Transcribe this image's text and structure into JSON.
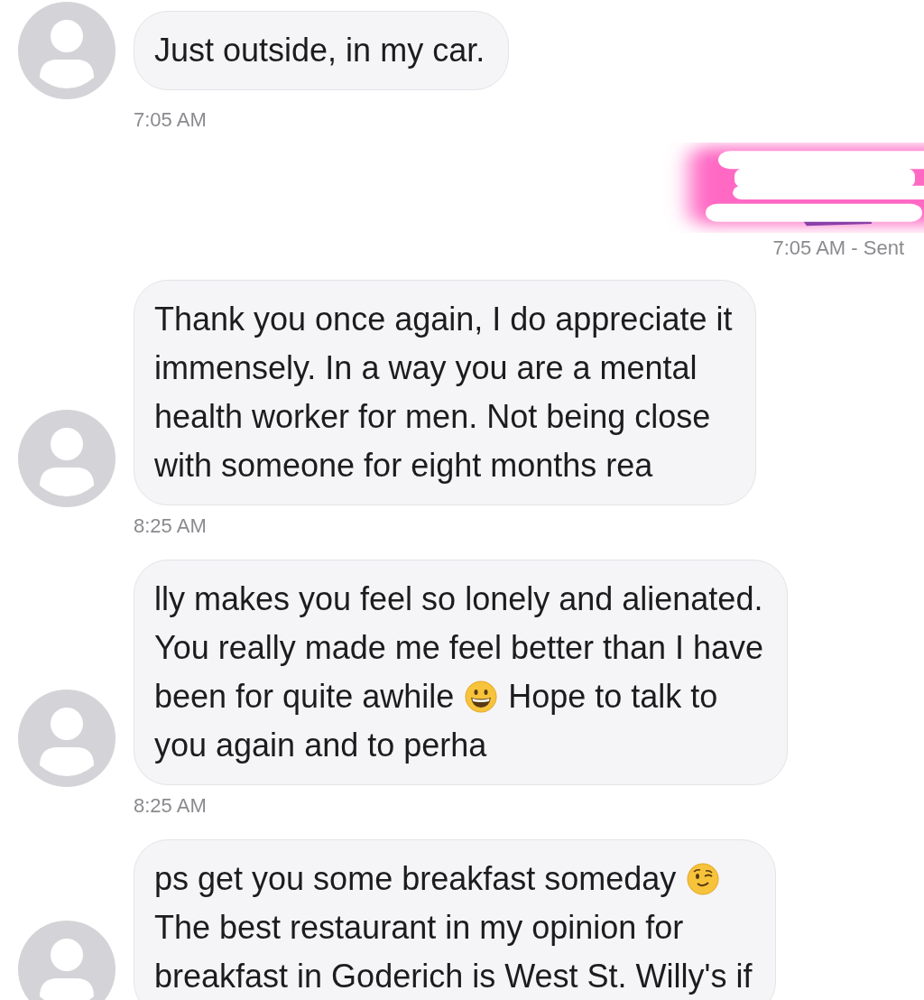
{
  "messages": [
    {
      "kind": "received",
      "lines": [
        [
          "Just outside, in my car."
        ]
      ],
      "time": "7:05 AM"
    },
    {
      "kind": "redacted",
      "time": "7:05 AM - Sent"
    },
    {
      "kind": "received",
      "lines": [
        [
          "Thank you once again, I do appreciate it"
        ],
        [
          "immensely. In a way you are a mental"
        ],
        [
          "health worker for men. Not being close"
        ],
        [
          "with someone for eight months rea"
        ]
      ],
      "time": "8:25 AM"
    },
    {
      "kind": "received",
      "lines": [
        [
          "lly makes you feel so lonely and alienated."
        ],
        [
          "You really made me feel better than I have"
        ],
        [
          "been for quite awhile",
          {
            "kind": "grin"
          },
          "Hope to talk to"
        ],
        [
          "you again and to perha"
        ]
      ],
      "time": "8:25 AM"
    },
    {
      "kind": "received",
      "lines": [
        [
          "ps get you some breakfast someday",
          {
            "kind": "wink"
          }
        ],
        [
          "The best restaurant in my opinion for"
        ],
        [
          "breakfast in Goderich is West St. Willy's if"
        ]
      ]
    }
  ]
}
